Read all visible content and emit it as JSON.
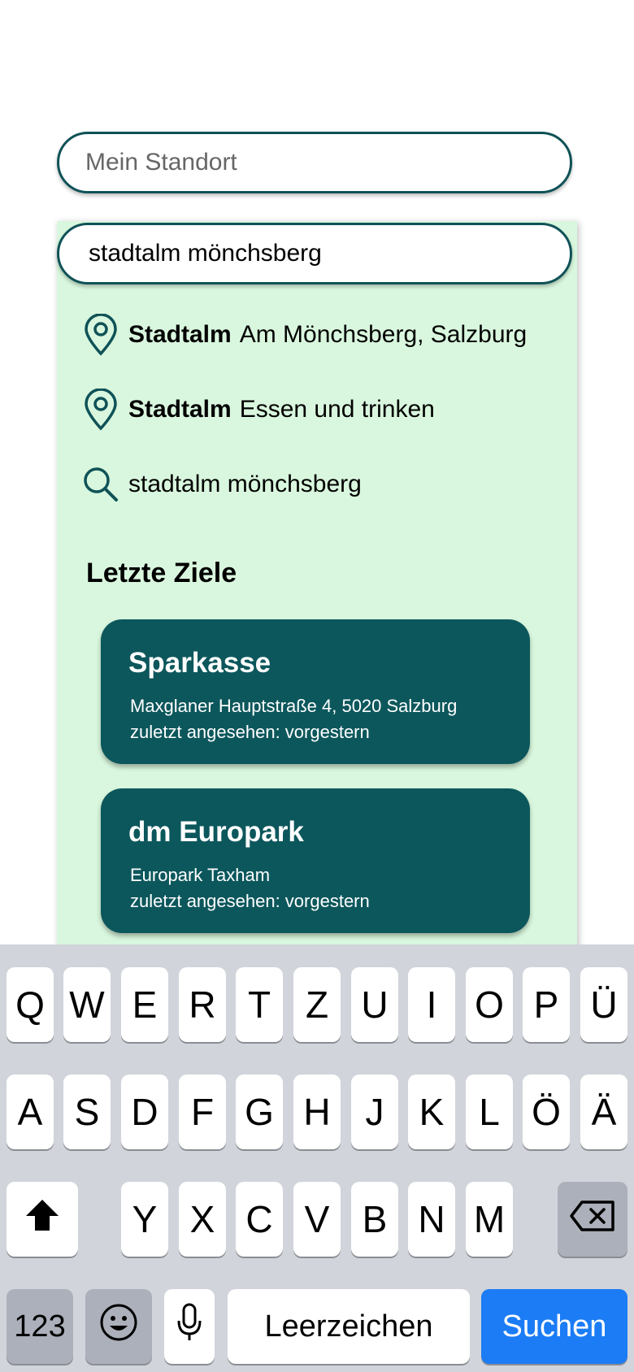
{
  "search": {
    "start_placeholder": "Mein Standort",
    "destination_value": "stadtalm mönchsberg"
  },
  "suggestions": [
    {
      "bold": "Stadtalm",
      "rest": "Am Mönchsberg, Salzburg",
      "icon": "location-pin-icon"
    },
    {
      "bold": "Stadtalm",
      "rest": "Essen und trinken",
      "icon": "location-pin-icon"
    },
    {
      "text": "stadtalm mönchsberg",
      "icon": "search-icon"
    }
  ],
  "recent": {
    "title": "Letzte Ziele",
    "items": [
      {
        "name": "Sparkasse",
        "address": "Maxglaner Hauptstraße 4, 5020 Salzburg",
        "seen": "zuletzt angesehen: vorgestern"
      },
      {
        "name": "dm Europark",
        "address": "Europark Taxham",
        "seen": "zuletzt angesehen: vorgestern"
      }
    ]
  },
  "keyboard": {
    "row1": [
      "Q",
      "W",
      "E",
      "R",
      "T",
      "Z",
      "U",
      "I",
      "O",
      "P",
      "Ü"
    ],
    "row2": [
      "A",
      "S",
      "D",
      "F",
      "G",
      "H",
      "J",
      "K",
      "L",
      "Ö",
      "Ä"
    ],
    "row3": [
      "Y",
      "X",
      "C",
      "V",
      "B",
      "N",
      "M"
    ],
    "numbers_label": "123",
    "space_label": "Leerzeichen",
    "action_label": "Suchen"
  },
  "colors": {
    "accent": "#0f5257",
    "panel": "#d9f7de",
    "card": "#0c575c",
    "action": "#1b7cf6"
  }
}
